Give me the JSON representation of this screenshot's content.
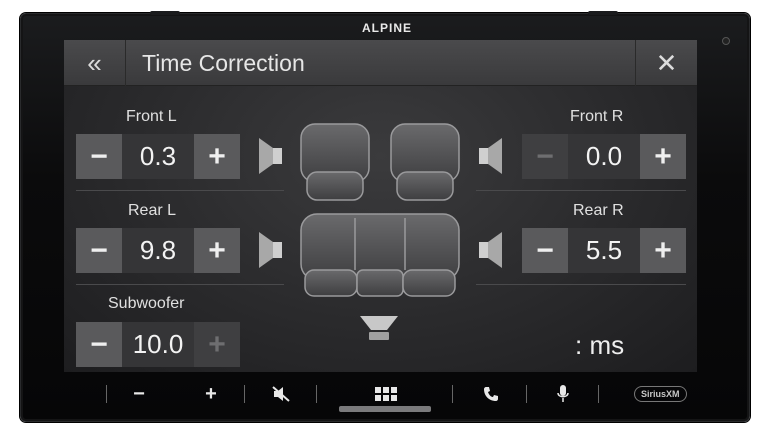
{
  "device": {
    "brand": "ALPINE"
  },
  "header": {
    "back_icon": "double-chevron-left-icon",
    "title": "Time Correction",
    "close_icon": "close-icon"
  },
  "channels": {
    "front_l": {
      "label": "Front L",
      "value": "0.3",
      "minus_enabled": true,
      "plus_enabled": true
    },
    "front_r": {
      "label": "Front R",
      "value": "0.0",
      "minus_enabled": false,
      "plus_enabled": true
    },
    "rear_l": {
      "label": "Rear L",
      "value": "9.8",
      "minus_enabled": true,
      "plus_enabled": true
    },
    "rear_r": {
      "label": "Rear R",
      "value": "5.5",
      "minus_enabled": true,
      "plus_enabled": true
    },
    "subwoofer": {
      "label": "Subwoofer",
      "value": "10.0",
      "minus_enabled": true,
      "plus_enabled": false
    }
  },
  "stepper": {
    "minus": "−",
    "plus": "+"
  },
  "unit": ": ms",
  "hardware_buttons": {
    "vol_down": "−",
    "vol_up": "+",
    "sirius": "SiriusXM"
  },
  "colors": {
    "screen_bg": "#2d2d2f",
    "button": "#5a5a5c",
    "value_bg": "#353537"
  }
}
